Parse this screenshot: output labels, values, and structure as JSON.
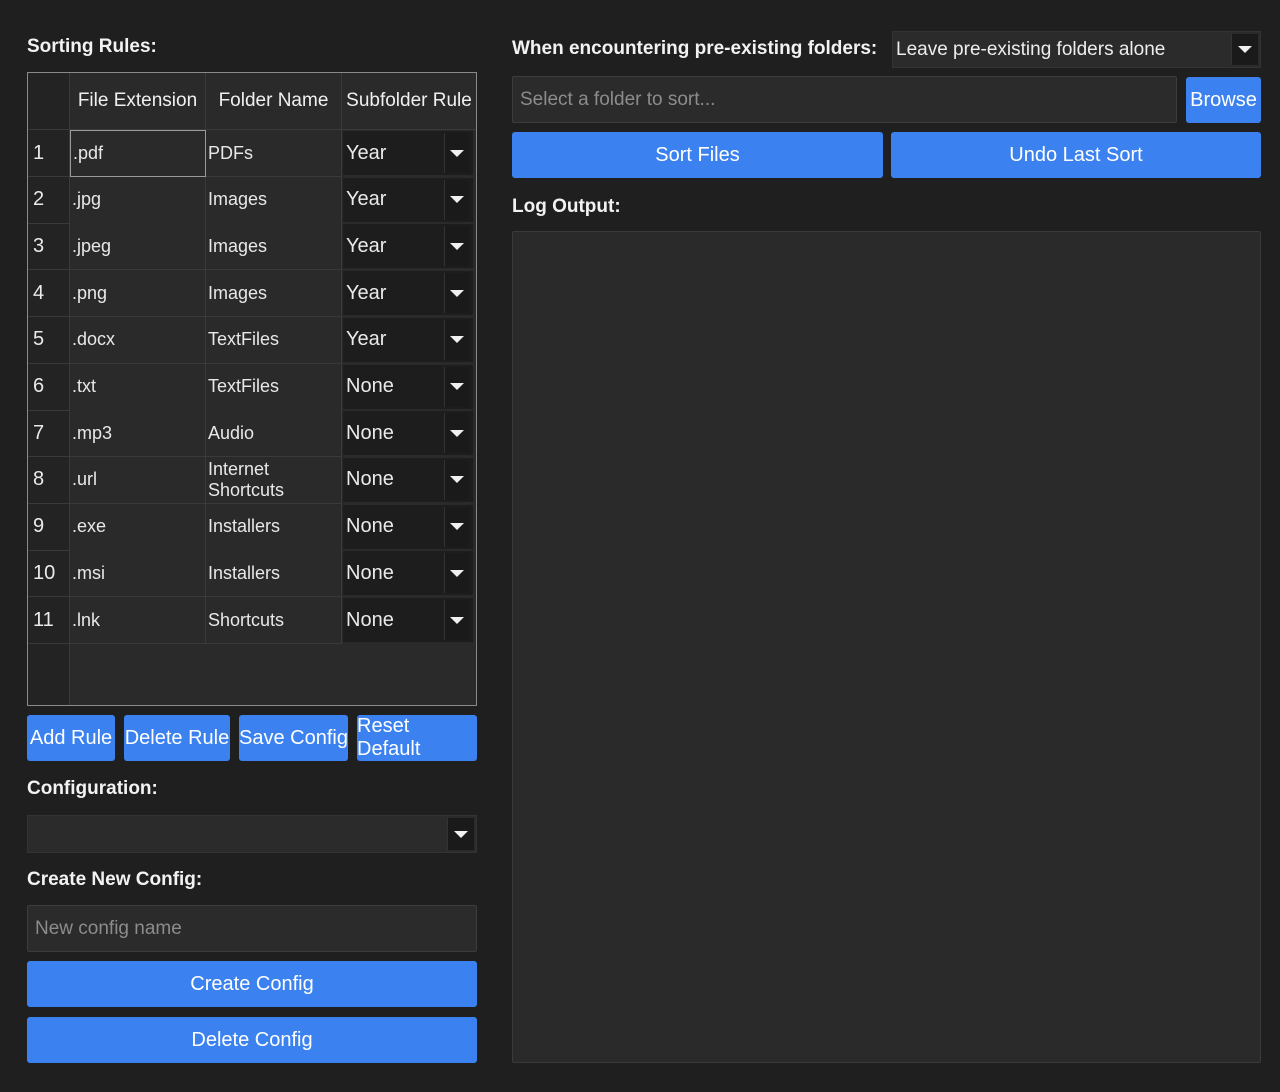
{
  "left": {
    "sorting_rules_label": "Sorting Rules:",
    "columns": [
      "File Extension",
      "Folder Name",
      "Subfolder Rule"
    ],
    "rows": [
      {
        "num": "1",
        "ext": ".pdf",
        "folder": "PDFs",
        "rule": "Year"
      },
      {
        "num": "2",
        "ext": ".jpg",
        "folder": "Images",
        "rule": "Year"
      },
      {
        "num": "3",
        "ext": ".jpeg",
        "folder": "Images",
        "rule": "Year"
      },
      {
        "num": "4",
        "ext": ".png",
        "folder": "Images",
        "rule": "Year"
      },
      {
        "num": "5",
        "ext": ".docx",
        "folder": "TextFiles",
        "rule": "Year"
      },
      {
        "num": "6",
        "ext": ".txt",
        "folder": "TextFiles",
        "rule": "None"
      },
      {
        "num": "7",
        "ext": ".mp3",
        "folder": "Audio",
        "rule": "None"
      },
      {
        "num": "8",
        "ext": ".url",
        "folder": "Internet Shortcuts",
        "rule": "None"
      },
      {
        "num": "9",
        "ext": ".exe",
        "folder": "Installers",
        "rule": "None"
      },
      {
        "num": "10",
        "ext": ".msi",
        "folder": "Installers",
        "rule": "None"
      },
      {
        "num": "11",
        "ext": ".lnk",
        "folder": "Shortcuts",
        "rule": "None"
      }
    ],
    "buttons": {
      "add_rule": "Add Rule",
      "delete_rule": "Delete Rule",
      "save_config": "Save Config",
      "reset_default": "Reset Default"
    },
    "configuration_label": "Configuration:",
    "configuration_value": "",
    "create_new_config_label": "Create New Config:",
    "new_config_placeholder": "New config name",
    "create_config": "Create Config",
    "delete_config": "Delete Config"
  },
  "right": {
    "preexisting_label": "When encountering pre-existing folders:",
    "preexisting_value": "Leave pre-existing folders alone",
    "folder_placeholder": "Select a folder to sort...",
    "browse": "Browse",
    "sort_files": "Sort Files",
    "undo_last_sort": "Undo Last Sort",
    "log_output_label": "Log Output:"
  },
  "colors": {
    "background": "#1f1f1f",
    "accent": "#3b82f0",
    "panel": "#2a2a2a"
  }
}
